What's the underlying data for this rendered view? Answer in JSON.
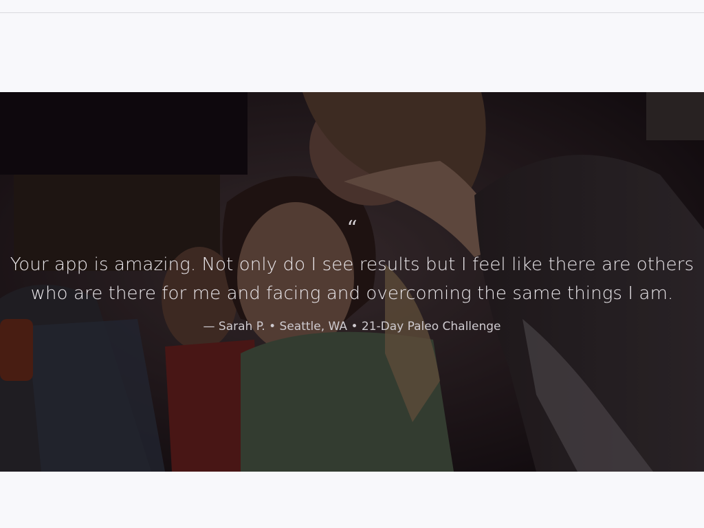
{
  "testimonial": {
    "quote_mark": "“",
    "quote_lines": [
      "Your app is amazing. Not only do I see results but I feel like there are others",
      "who are there for me and facing and overcoming the same things I am."
    ],
    "attribution": "— Sarah P. • Seattle, WA • 21-Day Paleo Challenge"
  },
  "colors": {
    "page_background": "#f8f8fb",
    "quote_text": "#ece9ed",
    "overlay": "#0a060a"
  }
}
